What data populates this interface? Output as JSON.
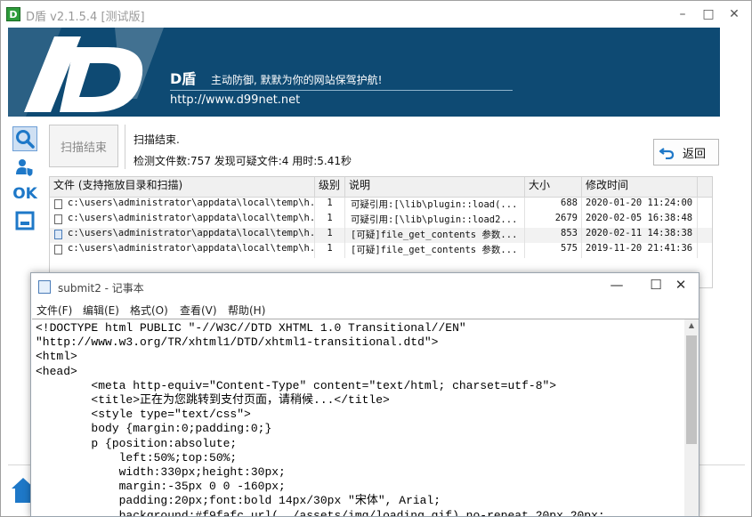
{
  "app": {
    "title": "D盾 v2.1.5.4 [测试版]",
    "icon_letter": "D",
    "controls": {
      "minimize": "–",
      "maximize": "□",
      "close": "✕"
    }
  },
  "banner": {
    "brand": "D盾",
    "tagline": "主动防御, 默默为你的网站保驾护航!",
    "url": "http://www.d99net.net"
  },
  "sidebar": {
    "items": [
      {
        "icon": "search-icon"
      },
      {
        "icon": "user-shield-icon"
      },
      {
        "label": "OK"
      },
      {
        "icon": "window-icon"
      }
    ]
  },
  "scan": {
    "button_label": "扫描结束",
    "status_line1": "扫描结束.",
    "status_line2": "检测文件数:757 发现可疑文件:4 用时:5.41秒",
    "back_label": "返回"
  },
  "table": {
    "columns": [
      "文件 (支持拖放目录和扫描)",
      "级别",
      "说明",
      "大小",
      "修改时间"
    ],
    "rows": [
      {
        "file": "c:\\users\\administrator\\appdata\\local\\temp\\h...",
        "level": "1",
        "desc": "可疑引用:[\\lib\\plugin::load(...",
        "size": "688",
        "time": "2020-01-20 11:24:00"
      },
      {
        "file": "c:\\users\\administrator\\appdata\\local\\temp\\h...",
        "level": "1",
        "desc": "可疑引用:[\\lib\\plugin::load2...",
        "size": "2679",
        "time": "2020-02-05 16:38:48"
      },
      {
        "file": "c:\\users\\administrator\\appdata\\local\\temp\\h...",
        "level": "1",
        "desc": "[可疑]file_get_contents 参数...",
        "size": "853",
        "time": "2020-02-11 14:38:38"
      },
      {
        "file": "c:\\users\\administrator\\appdata\\local\\temp\\h...",
        "level": "1",
        "desc": "[可疑]file_get_contents 参数...",
        "size": "575",
        "time": "2019-11-20 21:41:36"
      }
    ]
  },
  "notepad": {
    "title": "submit2 - 记事本",
    "controls": {
      "minimize": "—",
      "maximize": "☐",
      "close": "✕"
    },
    "menu": [
      "文件(F)",
      "编辑(E)",
      "格式(O)",
      "查看(V)",
      "帮助(H)"
    ],
    "content": "<!DOCTYPE html PUBLIC \"-//W3C//DTD XHTML 1.0 Transitional//EN\"\n\"http://www.w3.org/TR/xhtml1/DTD/xhtml1-transitional.dtd\">\n<html>\n<head>\n        <meta http-equiv=\"Content-Type\" content=\"text/html; charset=utf-8\">\n        <title>正在为您跳转到支付页面，请稍候...</title>\n        <style type=\"text/css\">\n        body {margin:0;padding:0;}\n        p {position:absolute;\n            left:50%;top:50%;\n            width:330px;height:30px;\n            margin:-35px 0 0 -160px;\n            padding:20px;font:bold 14px/30px \"宋体\", Arial;\n            background:#f9fafc url(../assets/img/loading.gif) no-repeat 20px 20px;"
  },
  "colors": {
    "banner_bg": "#0e4a73",
    "accent": "#1e78c8"
  }
}
